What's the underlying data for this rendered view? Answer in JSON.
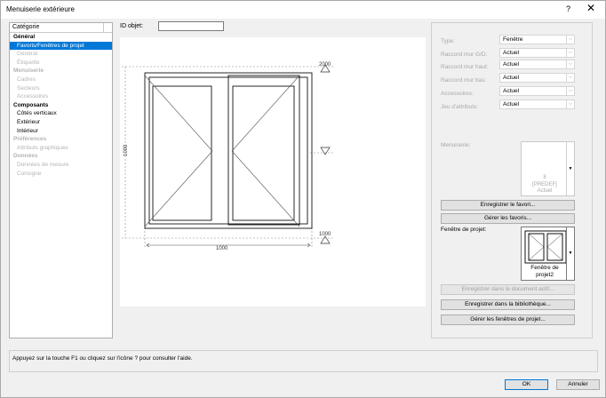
{
  "window": {
    "title": "Menuiserie extérieure",
    "help": "?",
    "close": "✕"
  },
  "category": {
    "header": "Catégorie",
    "items": [
      {
        "label": "Général",
        "kind": "group",
        "disabled": false,
        "selected": false
      },
      {
        "label": "Favoris/Fenêtres de projet",
        "kind": "sub",
        "disabled": false,
        "selected": true
      },
      {
        "label": "Général",
        "kind": "sub",
        "disabled": true,
        "selected": false
      },
      {
        "label": "Étiquette",
        "kind": "sub",
        "disabled": true,
        "selected": false
      },
      {
        "label": "Menuiserie",
        "kind": "group",
        "disabled": true,
        "selected": false
      },
      {
        "label": "Cadres",
        "kind": "sub",
        "disabled": true,
        "selected": false
      },
      {
        "label": "Secteurs",
        "kind": "sub",
        "disabled": true,
        "selected": false
      },
      {
        "label": "Accessoires",
        "kind": "sub",
        "disabled": true,
        "selected": false
      },
      {
        "label": "Composants",
        "kind": "group",
        "disabled": false,
        "selected": false
      },
      {
        "label": "Côtés verticaux",
        "kind": "sub",
        "disabled": false,
        "selected": false
      },
      {
        "label": "Extérieur",
        "kind": "sub",
        "disabled": false,
        "selected": false
      },
      {
        "label": "Intérieur",
        "kind": "sub",
        "disabled": false,
        "selected": false
      },
      {
        "label": "Préférences",
        "kind": "group",
        "disabled": true,
        "selected": false
      },
      {
        "label": "Attributs graphiques",
        "kind": "sub",
        "disabled": true,
        "selected": false
      },
      {
        "label": "Données",
        "kind": "group",
        "disabled": true,
        "selected": false
      },
      {
        "label": "Données de mesure",
        "kind": "sub",
        "disabled": true,
        "selected": false
      },
      {
        "label": "Consigne",
        "kind": "sub",
        "disabled": true,
        "selected": false
      }
    ]
  },
  "object_id": {
    "label": "ID objet:",
    "value": ""
  },
  "drawing": {
    "dim_top": "2000",
    "dim_bottom": "1000",
    "dim_left": "1000",
    "dim_width": "1000"
  },
  "properties": [
    {
      "label": "Type:",
      "value": "Fenêtre"
    },
    {
      "label": "Raccord mur G/D:",
      "value": "Actuel"
    },
    {
      "label": "Raccord mur haut:",
      "value": "Actuel"
    },
    {
      "label": "Raccord mur bas:",
      "value": "Actuel"
    },
    {
      "label": "Accessoires:",
      "value": "Actuel"
    },
    {
      "label": "Jeu d'attributs:",
      "value": "Actuel"
    }
  ],
  "menuiserie": {
    "label": "Menuiserie:",
    "line1": "8",
    "line2": "[PREDEF]",
    "line3": "Actuel"
  },
  "buttons": {
    "save_favorite": "Enregistrer le favori...",
    "manage_favorites": "Gérer les favoris...",
    "save_document": "Enregistrer dans le document actif...",
    "save_library": "Enregistrer dans la bibliothèque...",
    "manage_windows": "Gérer les fenêtres de projet...",
    "ok": "OK",
    "cancel": "Annuler"
  },
  "project_window": {
    "label": "Fenêtre de projet:",
    "caption_line1": "Fenêtre de",
    "caption_line2": "projet2"
  },
  "help_text": "Appuyez sur la touche F1 ou cliquez sur l'icône ? pour consulter l'aide.",
  "icons": {
    "dropdown": "chevron-down-icon",
    "close": "close-icon",
    "help": "help-icon"
  }
}
